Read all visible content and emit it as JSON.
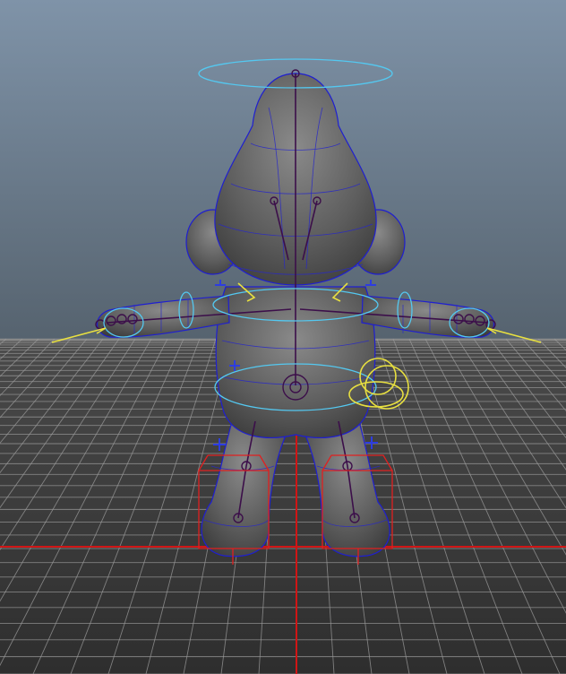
{
  "viewport": {
    "colors": {
      "sky_top": "#7f93a8",
      "sky_bottom": "#5b6b7c",
      "floor": "#3d3d3d",
      "grid": "#9a9a9a",
      "axis": "#d01515",
      "mesh": "#6a6a6a",
      "wireframe": "#1f1fd0",
      "skeleton": "#3c0f4a",
      "controller_cyan": "#54c8f0",
      "controller_yellow": "#e8e040",
      "controller_blue": "#2d3de0",
      "controller_red": "#e02020"
    },
    "icons": {
      "head_control": "ellipse-controller-icon",
      "hip_control": "ring-controller-icon",
      "ik_handle": "cross-handle-icon",
      "pole_vector": "arrow-pole-icon"
    }
  }
}
